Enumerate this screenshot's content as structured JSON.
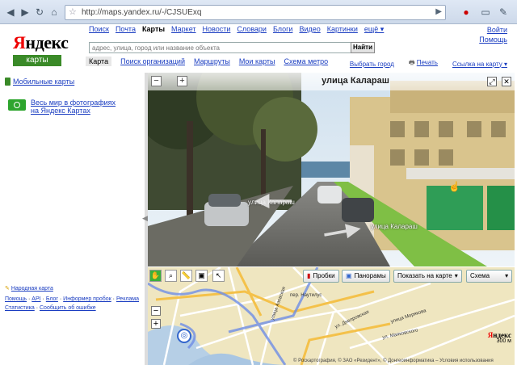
{
  "browser": {
    "url": "http://maps.yandex.ru/-/CJSUExq"
  },
  "logo": {
    "brand_first": "Я",
    "brand_rest": "ндекс",
    "product": "карты"
  },
  "services": [
    "Поиск",
    "Почта",
    "Карты",
    "Маркет",
    "Новости",
    "Словари",
    "Блоги",
    "Видео",
    "Картинки",
    "ещё ▾"
  ],
  "services_current": "Карты",
  "login": {
    "enter": "Войти",
    "help": "Помощь"
  },
  "search": {
    "placeholder": "адрес, улица, город или название объекта",
    "button": "Найти"
  },
  "tabs": [
    "Карта",
    "Поиск организаций",
    "Маршруты",
    "Мои карты",
    "Схема метро"
  ],
  "tabs_current": "Карта",
  "city_link": "Выбрать город",
  "print": "Печать",
  "map_link": "Ссылка на карту ▾",
  "left": {
    "mobile": "Мобильные карты",
    "photos": "Весь мир в фотографиях на Яндекс Картах",
    "people_map": "Народная карта",
    "footer_line1": [
      "Помощь",
      "API",
      "Блог",
      "Информер пробок",
      "Реклама"
    ],
    "footer_line2": [
      "Статистика",
      "Сообщить об ошибке"
    ]
  },
  "panorama": {
    "title": "улица Калараш",
    "labels": [
      "улица Калараш",
      "улица Калараш"
    ]
  },
  "map": {
    "traffic": "Пробки",
    "panoramas": "Панорамы",
    "show": "Показать на карте",
    "layer": "Схема",
    "street_labels": [
      "пер. Наутилус",
      "улица Морякова",
      "ул. Маяковского",
      "ул. Днепровская",
      "улица Азовская"
    ],
    "scale": "300 м",
    "copyright": "© Роскартография, © ЗАО «Резидент», © Донгеоинформатика – Условия использования",
    "brand_first": "Я",
    "brand_rest": "ндекс"
  },
  "colors": {
    "link": "#1a3dc1",
    "green": "#3a8a28",
    "red": "#e00000"
  }
}
